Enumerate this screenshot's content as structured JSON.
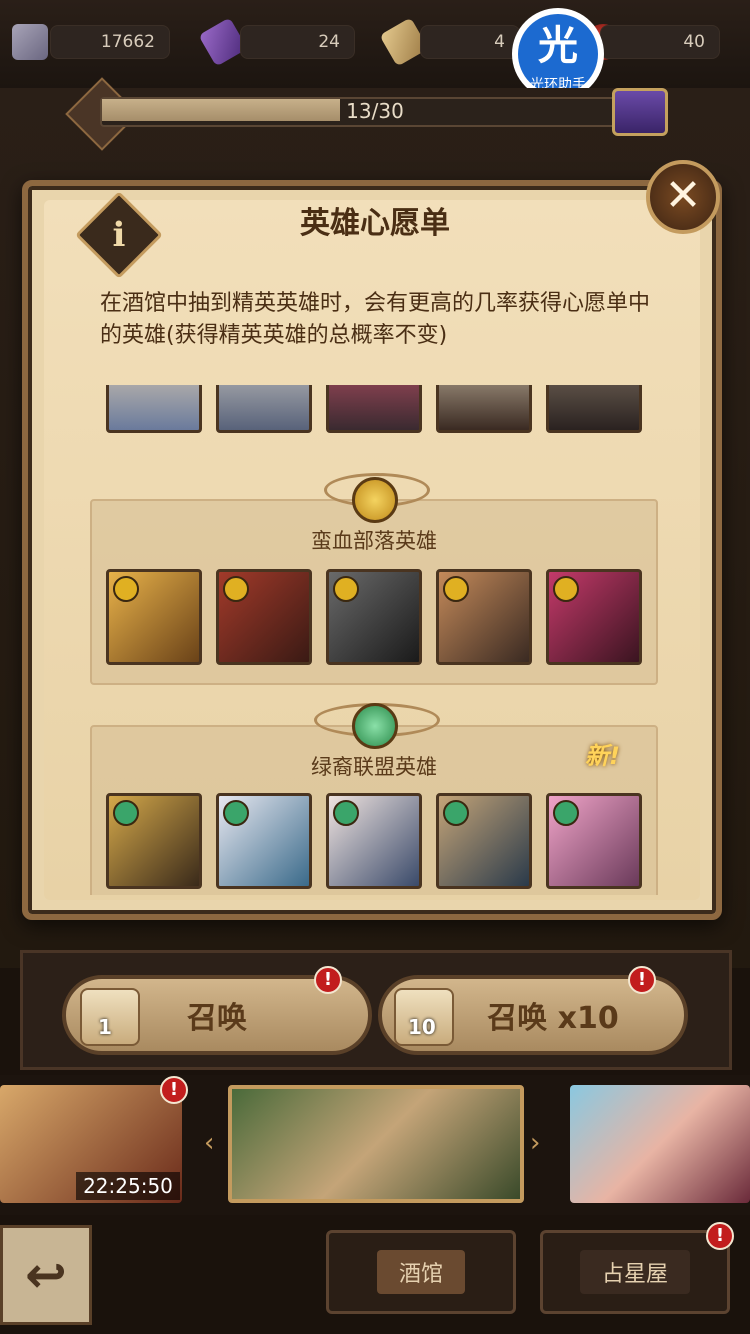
{
  "resources": [
    {
      "name": "diamonds",
      "icon": "diamond-icon",
      "value": "17662"
    },
    {
      "name": "purple-scroll",
      "icon": "purple-scroll-icon",
      "value": "24"
    },
    {
      "name": "scroll",
      "icon": "scroll-icon",
      "value": "4"
    },
    {
      "name": "red-item",
      "icon": "red-orb-icon",
      "value": "40"
    }
  ],
  "watermark": {
    "glyph": "光",
    "text": "光环助手"
  },
  "progress": {
    "text": "13/30",
    "fraction": 0.43
  },
  "dialog": {
    "title": "英雄心愿单",
    "info_label": "i",
    "close_label": "✕",
    "description": "在酒馆中抽到精英英雄时，会有更高的几率获得心愿单中的英雄(获得精英英雄的总概率不变)",
    "sections": [
      {
        "title": "蛮血部落英雄",
        "color": "#e0b022",
        "badge_color": "#e0b022",
        "heroes": [
          "hero-lion",
          "hero-werewolf",
          "hero-wolf-warrior",
          "hero-beast-pair",
          "hero-fox-girl"
        ]
      },
      {
        "title": "绿裔联盟英雄",
        "color": "#3aa56a",
        "badge_color": "#3aa56a",
        "new_label": "新!",
        "heroes": [
          "hero-golden-knight",
          "hero-bunny-mage",
          "hero-goat-girl",
          "hero-elf-warrior",
          "hero-pink-dragon"
        ]
      }
    ]
  },
  "summon": {
    "single": {
      "label": "召唤",
      "count": "1",
      "badge": "!"
    },
    "multi": {
      "label": "召唤 x10",
      "count": "10",
      "badge": "!"
    }
  },
  "banners": {
    "timer": "22:25:50",
    "left_badge": "!"
  },
  "nav": {
    "back_icon": "back-arrow-icon",
    "tavern": "酒馆",
    "stargazing": "占星屋",
    "stargazing_badge": "!"
  }
}
